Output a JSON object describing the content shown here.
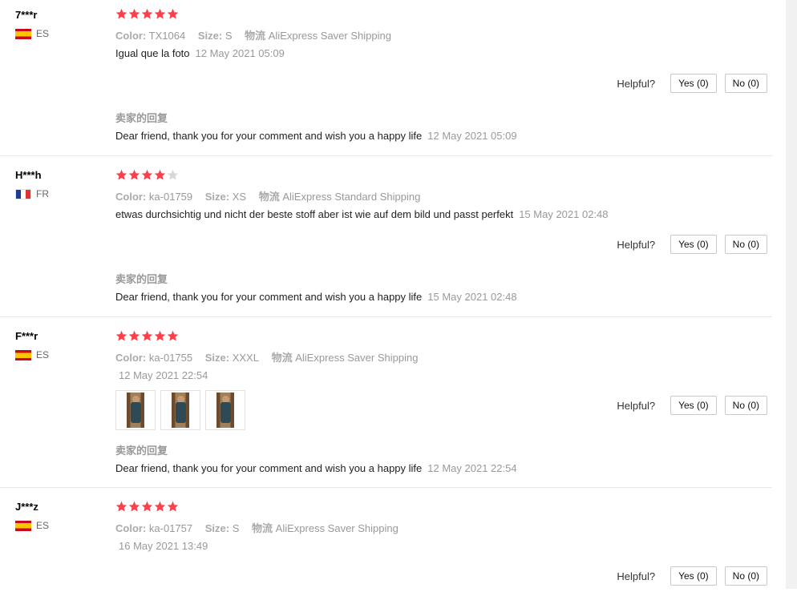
{
  "colors": {
    "star_filled": "#f5424b",
    "star_empty": "#d8d8d8"
  },
  "labels": {
    "color": "Color:",
    "size": "Size:",
    "logistics": "物流",
    "helpful": "Helpful?",
    "yes": "Yes (0)",
    "no": "No (0)",
    "reply_title": "卖家的回复"
  },
  "reviews": [
    {
      "user": "7***r",
      "country": "ES",
      "flag": "flag-es",
      "rating": 5,
      "color": "TX1064",
      "size": "S",
      "shipping": "AliExpress Saver Shipping",
      "text": "Igual que la foto",
      "date": "12 May 2021 05:09",
      "reply": "Dear friend, thank you for your comment and wish you a happy life",
      "reply_date": "12 May 2021 05:09"
    },
    {
      "user": "H***h",
      "country": "FR",
      "flag": "flag-fr",
      "rating": 4,
      "color": "ka-01759",
      "size": "XS",
      "shipping": "AliExpress Standard Shipping",
      "text": "etwas durchsichtig und nicht der beste stoff aber ist wie auf dem bild und passt perfekt",
      "date": "15 May 2021 02:48",
      "reply": "Dear friend, thank you for your comment and wish you a happy life",
      "reply_date": "15 May 2021 02:48"
    },
    {
      "user": "F***r",
      "country": "ES",
      "flag": "flag-es",
      "rating": 5,
      "color": "ka-01755",
      "size": "XXXL",
      "shipping": "AliExpress Saver Shipping",
      "text": "",
      "date": "12 May 2021 22:54",
      "photos": [
        "review-photo",
        "review-photo",
        "review-photo"
      ],
      "reply": "Dear friend, thank you for your comment and wish you a happy life",
      "reply_date": "12 May 2021 22:54"
    },
    {
      "user": "J***z",
      "country": "ES",
      "flag": "flag-es",
      "rating": 5,
      "color": "ka-01757",
      "size": "S",
      "shipping": "AliExpress Saver Shipping",
      "text": "",
      "date": "16 May 2021 13:49"
    }
  ]
}
